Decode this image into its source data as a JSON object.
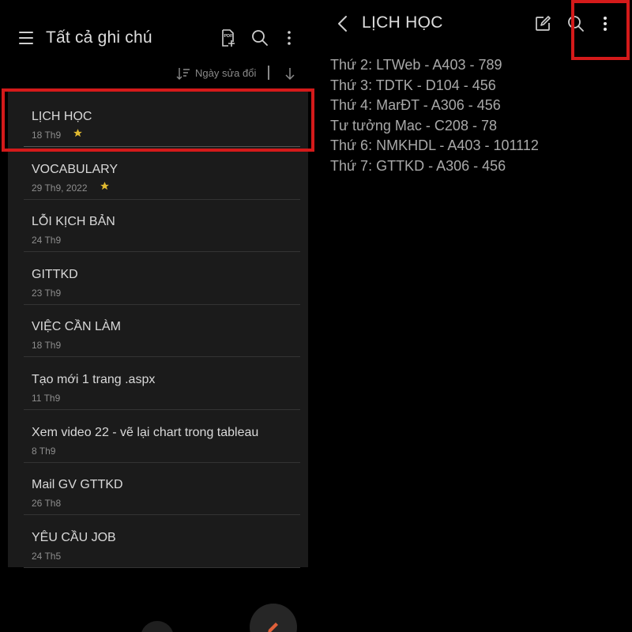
{
  "left_pane": {
    "title": "Tất cả ghi chú",
    "icons": [
      "menu-icon",
      "pdf-add-icon",
      "search-icon",
      "more-vert-icon"
    ],
    "sort": {
      "label": "Ngày sửa đổi",
      "icon": "sort-icon",
      "direction_icon": "arrow-down-icon"
    },
    "notes": [
      {
        "title": "LỊCH HỌC",
        "date": "18 Th9",
        "starred": true
      },
      {
        "title": "VOCABULARY",
        "date": "29 Th9, 2022",
        "starred": true
      },
      {
        "title": "LỖI KỊCH BẢN",
        "date": "24 Th9",
        "starred": false
      },
      {
        "title": "GITTKD",
        "date": "23 Th9",
        "starred": false
      },
      {
        "title": "VIỆC CẦN LÀM",
        "date": "18 Th9",
        "starred": false
      },
      {
        "title": "Tạo mới 1 trang .aspx",
        "date": "11 Th9",
        "starred": false
      },
      {
        "title": "Xem video 22 - vẽ lại chart trong tableau",
        "date": "8 Th9",
        "starred": false
      },
      {
        "title": "Mail GV GTTKD",
        "date": "26 Th8",
        "starred": false
      },
      {
        "title": "YÊU CẦU JOB",
        "date": "24 Th5",
        "starred": false
      }
    ]
  },
  "right_pane": {
    "title": "LỊCH HỌC",
    "icons": [
      "back-icon",
      "edit-icon",
      "search-icon",
      "more-vert-icon"
    ],
    "lines": [
      "Thứ 2: LTWeb - A403 - 789",
      "Thứ 3: TDTK - D104 - 456",
      "Thứ 4: MarĐT - A306 - 456",
      "Tư tưởng Mac - C208 - 78",
      "Thứ 6: NMKHDL - A403 - 101112",
      "Thứ 7: GTTKD - A306 - 456"
    ]
  },
  "colors": {
    "background": "#000000",
    "list_panel": "#1b1b1b",
    "highlight": "#d41a1a",
    "star": "#e0b930",
    "text_primary": "#d9d9d9",
    "text_secondary": "#8d8d8d"
  }
}
